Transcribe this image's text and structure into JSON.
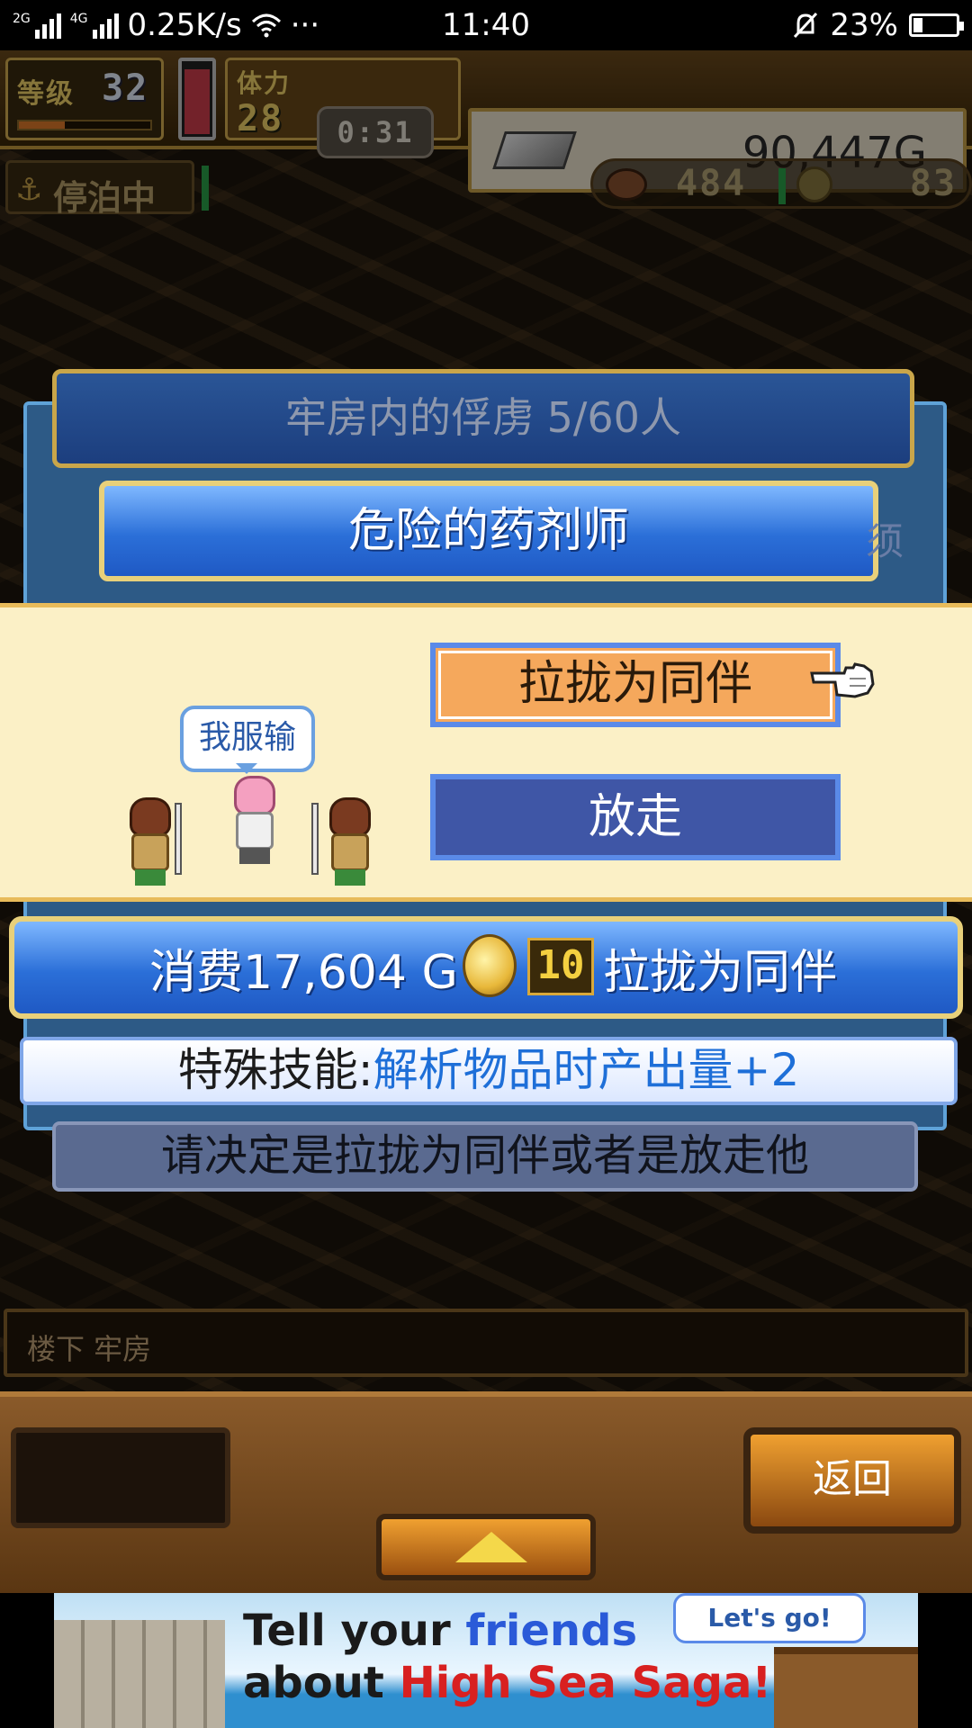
{
  "status_bar": {
    "network_1": "2G",
    "network_2": "4G",
    "speed": "0.25K/s",
    "dots": "···",
    "time": "11:40",
    "battery": "23%",
    "battery_level": 0.23
  },
  "hud": {
    "level_label": "等级",
    "level": "32",
    "level_progress": 0.35,
    "stamina_level": 0.9,
    "stamina_label": "体力",
    "stamina": "28",
    "timer": "0:31",
    "gold": "90,447G",
    "moored": "停泊中",
    "food": "484",
    "coins": "83"
  },
  "dialog": {
    "prisoners_title": "牢房内的俘虏  5/60人",
    "prisoner_name": "危险的药剂师",
    "edge_text": "须",
    "speech": "我服输",
    "recruit_button": "拉拢为同伴",
    "release_button": "放走",
    "cost": "消费17,604 G",
    "medal_count": "10",
    "cost_action": "拉拢为同伴",
    "skill_label": "特殊技能:",
    "skill_value": "解析物品时产出量+2",
    "prompt": "请决定是拉拢为同伴或者是放走他"
  },
  "location": "楼下 牢房",
  "nav": {
    "back": "返回"
  },
  "ad": {
    "line1_a": "Tell your ",
    "line1_b": "friends",
    "line2_a": "about ",
    "line2_b": "High Sea Saga!",
    "cta": "Let's go!"
  },
  "colors": {
    "accent_blue": "#2b6fd8",
    "gold_border": "#e8d07a",
    "band_bg": "#fbf0c6",
    "recruit_orange": "#f5a85c",
    "release_blue": "#3f56a6",
    "skill_highlight": "#1e6fd8"
  }
}
